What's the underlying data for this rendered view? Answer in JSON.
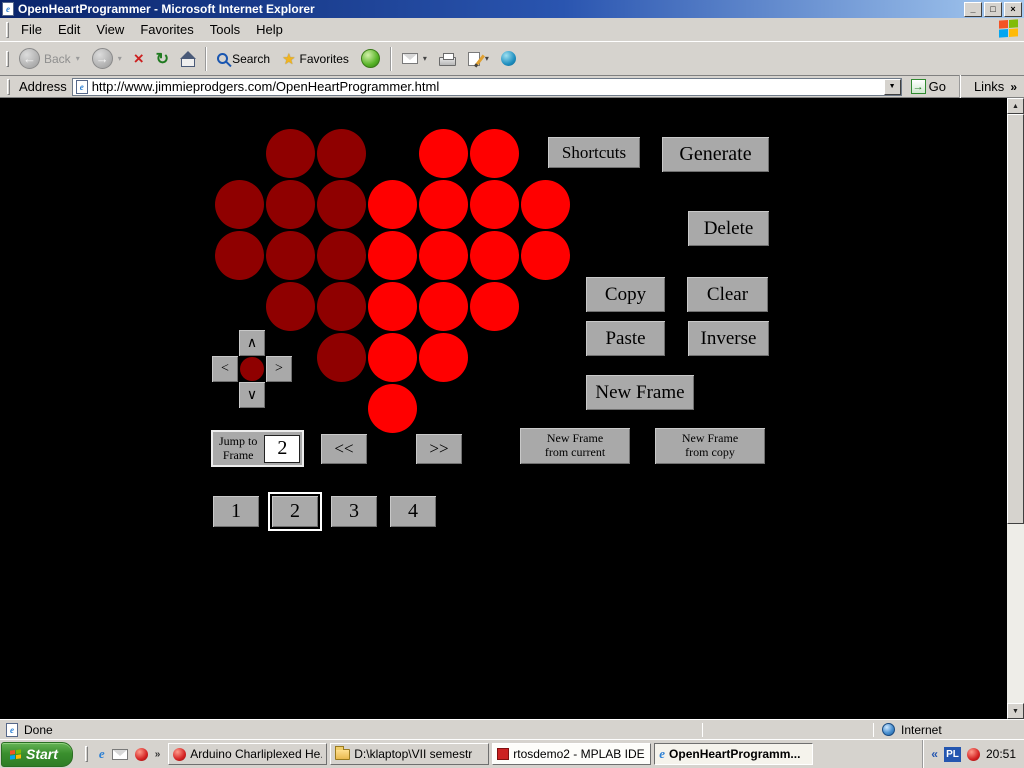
{
  "colors": {
    "titlebar_left": "#0a246a",
    "titlebar_right": "#a6caf0",
    "chrome": "#d6d3ce",
    "button_gray": "#a9a9a9",
    "content_bg": "#000000",
    "led_on": "#ff0000",
    "led_off": "#8f0000"
  },
  "icons": {
    "caret": "▾",
    "combo_drop": "▼",
    "scroll_up": "▲",
    "scroll_down": "▼",
    "back": "←",
    "forward": "→",
    "stop": "×",
    "refresh": "↻",
    "favorites_star": "★",
    "go_arrow": "→",
    "ie_e": "e"
  },
  "window": {
    "title": "OpenHeartProgrammer - Microsoft Internet Explorer",
    "minimize_glyph": "_",
    "maximize_glyph": "□",
    "close_glyph": "×"
  },
  "menu": {
    "items": [
      "File",
      "Edit",
      "View",
      "Favorites",
      "Tools",
      "Help"
    ]
  },
  "toolbar": {
    "back_label": "Back",
    "search_label": "Search",
    "favorites_label": "Favorites"
  },
  "address_bar": {
    "label": "Address",
    "url": "http://www.jimmieprodgers.com/OpenHeartProgrammer.html",
    "go_label": "Go",
    "links_label": "Links",
    "links_chevron": "»"
  },
  "content": {
    "buttons": {
      "shortcuts": "Shortcuts",
      "generate": "Generate",
      "delete": "Delete",
      "copy": "Copy",
      "clear": "Clear",
      "paste": "Paste",
      "inverse": "Inverse",
      "new_frame": "New Frame",
      "prev_frame": "<<",
      "next_frame": ">>",
      "new_frame_from_current_line1": "New Frame",
      "new_frame_from_current_line2": "from current",
      "new_frame_from_copy_line1": "New Frame",
      "new_frame_from_copy_line2": "from copy"
    },
    "jump_to_frame": {
      "label_line1": "Jump to",
      "label_line2": "Frame",
      "value": "2"
    },
    "cursor_pad": {
      "up": "∧",
      "down": "∨",
      "left": "<",
      "right": ">"
    },
    "frames": [
      {
        "label": "1",
        "selected": false
      },
      {
        "label": "2",
        "selected": true
      },
      {
        "label": "3",
        "selected": false
      },
      {
        "label": "4",
        "selected": false
      }
    ],
    "heart_pattern": [
      {
        "cols": [
          1,
          2,
          4,
          5
        ],
        "on": [
          0,
          0,
          1,
          1
        ]
      },
      {
        "cols": [
          0,
          1,
          2,
          3,
          4,
          5,
          6
        ],
        "on": [
          0,
          0,
          0,
          1,
          1,
          1,
          1
        ]
      },
      {
        "cols": [
          0,
          1,
          2,
          3,
          4,
          5,
          6
        ],
        "on": [
          0,
          0,
          0,
          1,
          1,
          1,
          1
        ]
      },
      {
        "cols": [
          1,
          2,
          3,
          4,
          5
        ],
        "on": [
          0,
          0,
          1,
          1,
          1
        ]
      },
      {
        "cols": [
          2,
          3,
          4
        ],
        "on": [
          0,
          1,
          1
        ]
      },
      {
        "cols": [
          3
        ],
        "on": [
          1
        ]
      }
    ]
  },
  "status_bar": {
    "text": "Done",
    "zone": "Internet"
  },
  "taskbar": {
    "start_label": "Start",
    "quick_launch_overflow": "»",
    "tasks": [
      {
        "label": "Arduino Charliplexed He...",
        "active": false,
        "highlight": false
      },
      {
        "label": "D:\\klaptop\\VII semestr",
        "active": false,
        "highlight": false
      },
      {
        "label": "rtosdemo2 - MPLAB IDE ...",
        "active": false,
        "highlight": true
      },
      {
        "label": "OpenHeartProgramm...",
        "active": true,
        "highlight": false
      }
    ],
    "tray": {
      "collapse_chevron": "«",
      "language": "PL",
      "time": "20:51"
    }
  }
}
